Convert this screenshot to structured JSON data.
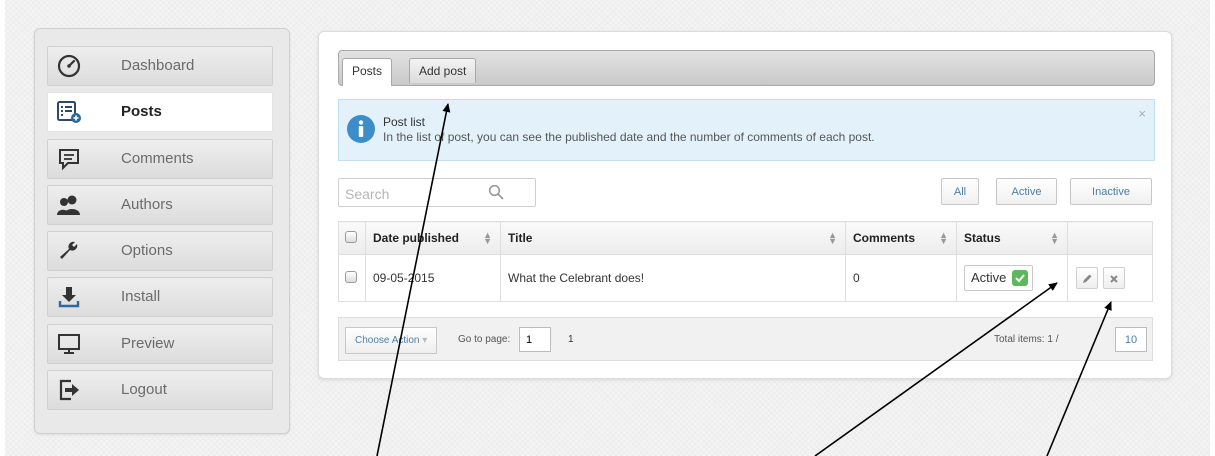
{
  "sidebar": {
    "items": [
      {
        "label": "Dashboard",
        "icon": "speedometer-icon",
        "active": false
      },
      {
        "label": "Posts",
        "icon": "post-list-add-icon",
        "active": true
      },
      {
        "label": "Comments",
        "icon": "speech-bubble-icon",
        "active": false
      },
      {
        "label": "Authors",
        "icon": "users-icon",
        "active": false
      },
      {
        "label": "Options",
        "icon": "wrench-icon",
        "active": false
      },
      {
        "label": "Install",
        "icon": "download-icon",
        "active": false
      },
      {
        "label": "Preview",
        "icon": "monitor-icon",
        "active": false
      },
      {
        "label": "Logout",
        "icon": "logout-icon",
        "active": false
      }
    ]
  },
  "tabs": [
    {
      "label": "Posts",
      "active": true
    },
    {
      "label": "Add post",
      "active": false
    }
  ],
  "info": {
    "title": "Post list",
    "message": "In the list of post, you can see the published date and the number of comments of each post.",
    "close": "×"
  },
  "search": {
    "placeholder": "Search"
  },
  "filters": {
    "all": "All",
    "active": "Active",
    "inactive": "Inactive"
  },
  "table": {
    "headers": {
      "date": "Date published",
      "title": "Title",
      "comments": "Comments",
      "status": "Status"
    },
    "rows": [
      {
        "date": "09-05-2015",
        "title": "What the Celebrant does!",
        "comments": "0",
        "status": "Active"
      }
    ]
  },
  "footer": {
    "choose_action": "Choose Action",
    "goto_label": "Go to page:",
    "page_value": "1",
    "page_count": "1",
    "total_label": "Total items: 1 /",
    "per_page": "10"
  },
  "colors": {
    "accent": "#4a7fa7",
    "status_green": "#5cb85c",
    "info_bg": "#e3f2fa"
  }
}
